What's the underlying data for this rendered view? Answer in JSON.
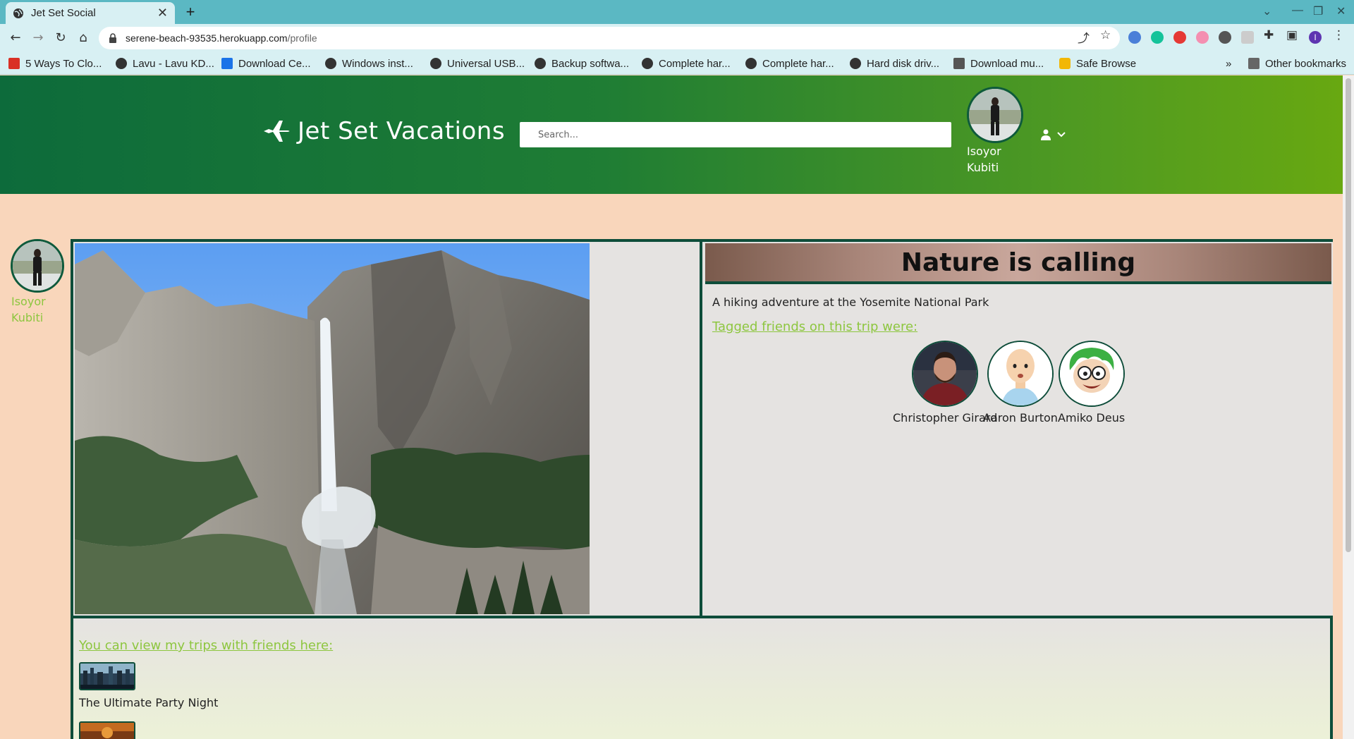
{
  "browser": {
    "tab_title": "Jet Set Social",
    "url_host": "serene-beach-93535.herokuapp.com",
    "url_path": "/profile",
    "bookmarks": [
      {
        "label": "5 Ways To Clo...",
        "color": "#d93025"
      },
      {
        "label": "Lavu - Lavu KD...",
        "color": "#333333"
      },
      {
        "label": "Download Ce...",
        "color": "#1a73e8"
      },
      {
        "label": "Windows inst...",
        "color": "#333333"
      },
      {
        "label": "Universal USB...",
        "color": "#333333"
      },
      {
        "label": "Backup softwa...",
        "color": "#333333"
      },
      {
        "label": "Complete har...",
        "color": "#333333"
      },
      {
        "label": "Complete har...",
        "color": "#333333"
      },
      {
        "label": "Hard disk driv...",
        "color": "#333333"
      },
      {
        "label": "Download mu...",
        "color": "#555555"
      },
      {
        "label": "Safe Browse",
        "color": "#f2b705"
      }
    ],
    "other_bookmarks": "Other bookmarks",
    "profile_initial": "I"
  },
  "header": {
    "brand": "Jet Set Vacations",
    "search_placeholder": "Search...",
    "username": "Isoyor Kubiti"
  },
  "sidebar": {
    "username": "Isoyor Kubiti"
  },
  "trip": {
    "title": "Nature is calling",
    "description": "A hiking adventure at the Yosemite National Park",
    "tagged_label": "Tagged friends on this trip were:",
    "friends": [
      {
        "name": "Christopher Girard"
      },
      {
        "name": "Aaron Burton"
      },
      {
        "name": "Amiko Deus"
      }
    ]
  },
  "friend_trips": {
    "label": "You can view my trips with friends here:",
    "items": [
      {
        "name": "The Ultimate Party Night"
      }
    ]
  },
  "colors": {
    "header_start": "#0d6b3b",
    "header_end": "#68a811",
    "page_bg": "#f9d6bb",
    "link_green": "#8dc63f",
    "border": "#0e4d3a"
  }
}
